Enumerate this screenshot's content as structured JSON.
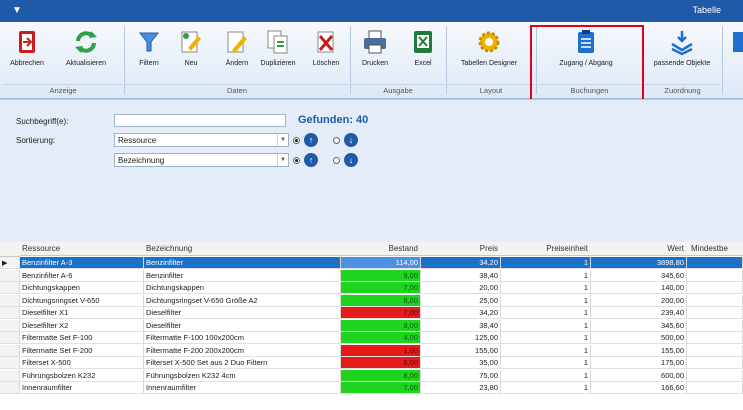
{
  "titlebar": {
    "quick_access": "▼",
    "title": "Tabelle"
  },
  "ribbon": {
    "buttons": [
      {
        "label": "Abbrechen",
        "icon": "exit-icon"
      },
      {
        "label": "Aktualisieren",
        "icon": "refresh-icon"
      },
      {
        "label": "Filtern",
        "icon": "filter-icon"
      },
      {
        "label": "Neu",
        "icon": "new-icon"
      },
      {
        "label": "Ändern",
        "icon": "edit-icon"
      },
      {
        "label": "Duplizieren",
        "icon": "duplicate-icon"
      },
      {
        "label": "Löschen",
        "icon": "delete-icon"
      },
      {
        "label": "Drucken",
        "icon": "printer-icon"
      },
      {
        "label": "Excel",
        "icon": "excel-icon"
      },
      {
        "label": "Tabellen Designer",
        "icon": "gear-icon"
      },
      {
        "label": "Zugang / Abgang",
        "icon": "clipboard-icon"
      },
      {
        "label": "passende Objekte",
        "icon": "assign-icon"
      }
    ],
    "groups": [
      "Anzeige",
      "Daten",
      "Ausgabe",
      "Layout",
      "Buchungen",
      "Zuordnung"
    ],
    "highlight_color": "#e0001b"
  },
  "search": {
    "label_search": "Suchbegriff(e):",
    "search_value": "",
    "found_text": "Gefunden: 40",
    "label_sort": "Sortierung:",
    "sort1": "Ressource",
    "sort2": "Bezeichnung"
  },
  "table": {
    "headers": [
      "Ressource",
      "Bezeichnung",
      "Bestand",
      "Preis",
      "Preiseinheit",
      "Wert",
      "Mindestbe"
    ],
    "rows": [
      {
        "res": "Benzinfilter A-3",
        "bez": "Benzinfilter",
        "bestand": "114,00",
        "preis": "34,20",
        "einheit": "1",
        "wert": "3898,80",
        "status": "selected"
      },
      {
        "res": "Benzinfilter A-6",
        "bez": "Benzinfilter",
        "bestand": "9,00",
        "preis": "38,40",
        "einheit": "1",
        "wert": "345,60",
        "status": "green"
      },
      {
        "res": "Dichtungskappen",
        "bez": "Dichtungskappen",
        "bestand": "7,00",
        "preis": "20,00",
        "einheit": "1",
        "wert": "140,00",
        "status": "green"
      },
      {
        "res": "Dichtungsringset V-650",
        "bez": "Dichtungsringset V-650 Größe A2",
        "bestand": "8,00",
        "preis": "25,00",
        "einheit": "1",
        "wert": "200,00",
        "status": "green"
      },
      {
        "res": "Dieselfilter X1",
        "bez": "Dieselfilter",
        "bestand": "7,00",
        "preis": "34,20",
        "einheit": "1",
        "wert": "239,40",
        "status": "red"
      },
      {
        "res": "Dieselfilter X2",
        "bez": "Dieselfilter",
        "bestand": "9,00",
        "preis": "38,40",
        "einheit": "1",
        "wert": "345,60",
        "status": "green"
      },
      {
        "res": "Filtermatte Set F-100",
        "bez": "Filtermatte F-100 100x200cm",
        "bestand": "4,00",
        "preis": "125,00",
        "einheit": "1",
        "wert": "500,00",
        "status": "green"
      },
      {
        "res": "Filtermatte Set F-200",
        "bez": "Filtermatte F-200 200x200cm",
        "bestand": "1,00",
        "preis": "155,00",
        "einheit": "1",
        "wert": "155,00",
        "status": "red"
      },
      {
        "res": "Filterset X-500",
        "bez": "Filterset X-500 Set aus 2 Duo Filtern",
        "bestand": "5,00",
        "preis": "35,00",
        "einheit": "1",
        "wert": "175,00",
        "status": "red"
      },
      {
        "res": "Führungsbolzen K232",
        "bez": "Führungsbolzen K232 4cm",
        "bestand": "8,00",
        "preis": "75,00",
        "einheit": "1",
        "wert": "600,00",
        "status": "green"
      },
      {
        "res": "Innenraumfilter",
        "bez": "Innenraumfilter",
        "bestand": "7,00",
        "preis": "23,80",
        "einheit": "1",
        "wert": "166,60",
        "status": "green"
      }
    ]
  },
  "colors": {
    "green": "#21d321",
    "red": "#e51b1b",
    "selected": "#1c70c8",
    "accent": "#1f5aa8"
  }
}
